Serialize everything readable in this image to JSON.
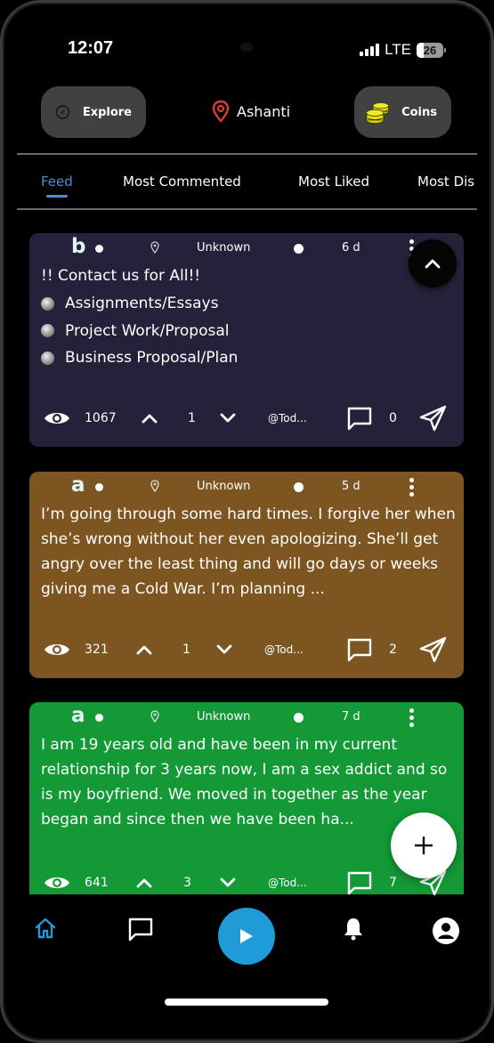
{
  "status_bar": {
    "time": "12:07",
    "network": "LTE",
    "battery": "26",
    "battery_level_percent": 26
  },
  "header": {
    "explore_label": "Explore",
    "location": "Ashanti",
    "coins_label": "Coins"
  },
  "tabs": [
    {
      "label": "Feed",
      "active": true
    },
    {
      "label": "Most Commented",
      "active": false
    },
    {
      "label": "Most Liked",
      "active": false
    },
    {
      "label": "Most Dis",
      "active": false
    }
  ],
  "posts": [
    {
      "avatar_letter": "b",
      "location": "Unknown",
      "time": "6 d",
      "background": "#25213a",
      "title": "!! Contact us for All!!",
      "bullets": [
        "Assignments/Essays",
        "Project Work/Proposal",
        "Business Proposal/Plan"
      ],
      "views": "1067",
      "score": "1",
      "handle": "@Tod...",
      "comments": "0"
    },
    {
      "avatar_letter": "a",
      "location": "Unknown",
      "time": "5 d",
      "background": "#7d5520",
      "text": "I’m going through some hard times. I forgive her when she’s wrong without her even apologizing. She’ll get angry over the least thing and will go days or weeks giving me a Cold War. I’m planning ...",
      "views": "321",
      "score": "1",
      "handle": "@Tod...",
      "comments": "2"
    },
    {
      "avatar_letter": "a",
      "location": "Unknown",
      "time": "7 d",
      "background": "#139a36",
      "text": "I am 19 years old and have been in my current relationship for 3 years now, I am a sex addict and so is my boyfriend. We moved in together as the year began and since then we have been ha...",
      "views": "641",
      "score": "3",
      "handle": "@Tod...",
      "comments": "7"
    }
  ],
  "bottom_nav": {
    "items": [
      "home",
      "messages",
      "play",
      "notifications",
      "profile"
    ],
    "active": "home",
    "accent": "#1f9bd7"
  }
}
